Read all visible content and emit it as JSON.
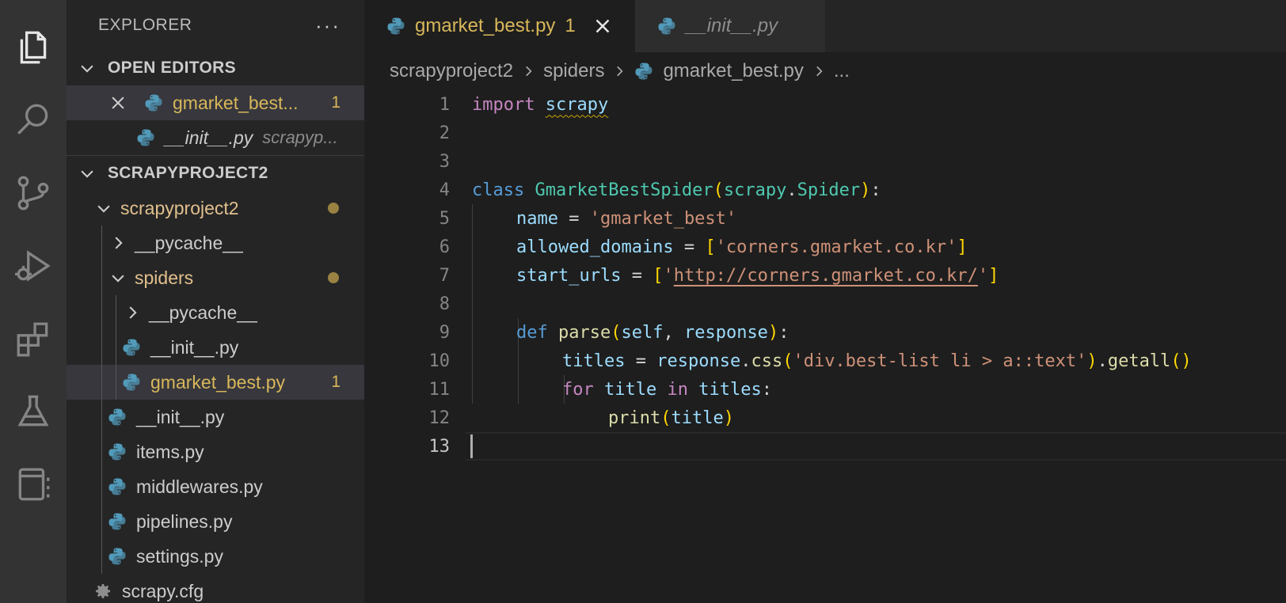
{
  "explorer": {
    "title": "EXPLORER",
    "more": "···"
  },
  "open_editors": {
    "title": "OPEN EDITORS",
    "items": [
      {
        "label": "gmarket_best...",
        "badge": "1"
      },
      {
        "label": "__init__.py",
        "desc": "scrapyp..."
      }
    ]
  },
  "project": {
    "title": "SCRAPYPROJECT2",
    "tree": [
      {
        "label": "scrapyproject2"
      },
      {
        "label": "__pycache__"
      },
      {
        "label": "spiders"
      },
      {
        "label": "__pycache__"
      },
      {
        "label": "__init__.py"
      },
      {
        "label": "gmarket_best.py",
        "badge": "1"
      },
      {
        "label": "__init__.py"
      },
      {
        "label": "items.py"
      },
      {
        "label": "middlewares.py"
      },
      {
        "label": "pipelines.py"
      },
      {
        "label": "settings.py"
      },
      {
        "label": "scrapy.cfg"
      }
    ]
  },
  "tabs": [
    {
      "label": "gmarket_best.py",
      "badge": "1"
    },
    {
      "label": "__init__.py"
    }
  ],
  "breadcrumb": [
    "scrapyproject2",
    "spiders",
    "gmarket_best.py",
    "..."
  ],
  "code": {
    "line_numbers": [
      "1",
      "2",
      "3",
      "4",
      "5",
      "6",
      "7",
      "8",
      "9",
      "10",
      "11",
      "12",
      "13"
    ],
    "tokens": {
      "l1_import": "import",
      "l1_scrapy": "scrapy",
      "l4_class": "class",
      "l4_name": "GmarketBestSpider",
      "l4_open": "(",
      "l4_mod": "scrapy",
      "l4_dot": ".",
      "l4_base": "Spider",
      "l4_close": ")",
      "l4_colon": ":",
      "l5_var": "name",
      "l5_eq": " = ",
      "l5_str": "'gmarket_best'",
      "l6_var": "allowed_domains",
      "l6_eq": " = ",
      "l6_open": "[",
      "l6_str": "'corners.gmarket.co.kr'",
      "l6_close": "]",
      "l7_var": "start_urls",
      "l7_eq": " = ",
      "l7_open": "[",
      "l7_q1": "'",
      "l7_url": "http://corners.gmarket.co.kr/",
      "l7_q2": "'",
      "l7_close": "]",
      "l9_def": "def",
      "l9_fn": "parse",
      "l9_open": "(",
      "l9_self": "self",
      "l9_comma": ", ",
      "l9_resp": "response",
      "l9_close": ")",
      "l9_colon": ":",
      "l10_var": "titles",
      "l10_eq": " = ",
      "l10_obj": "response",
      "l10_dot": ".",
      "l10_fn": "css",
      "l10_open": "(",
      "l10_str": "'div.best-list li > a::text'",
      "l10_close": ")",
      "l10_dot2": ".",
      "l10_fn2": "getall",
      "l10_call": "()",
      "l11_for": "for",
      "l11_var": "title",
      "l11_in": "in",
      "l11_iter": "titles",
      "l11_colon": ":",
      "l12_fn": "print",
      "l12_open": "(",
      "l12_arg": "title",
      "l12_close": ")"
    }
  },
  "colors": {
    "modified": "#e2c08d",
    "error": "#d8b75a",
    "python_icon": "#519aba"
  }
}
